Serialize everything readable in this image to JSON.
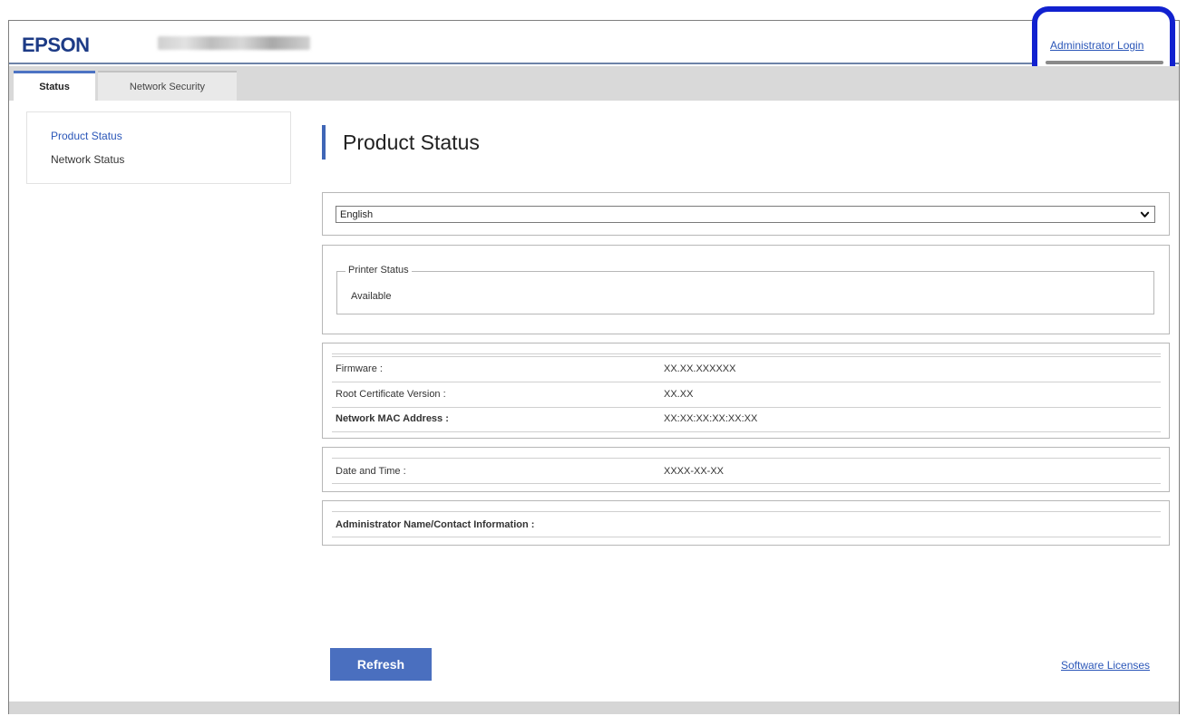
{
  "brand": {
    "logo": "EPSON"
  },
  "header": {
    "admin_login": "Administrator Login"
  },
  "tabs": [
    {
      "label": "Status",
      "active": true
    },
    {
      "label": "Network Security",
      "active": false
    }
  ],
  "sidebar": {
    "items": [
      {
        "label": "Product Status",
        "active": true
      },
      {
        "label": "Network Status",
        "active": false
      }
    ]
  },
  "main": {
    "title": "Product Status",
    "language": {
      "selected": "English"
    },
    "printer_status": {
      "legend": "Printer Status",
      "value": "Available"
    },
    "info": [
      {
        "label": "Firmware :",
        "value": "XX.XX.XXXXXX"
      },
      {
        "label": "Root Certificate Version :",
        "value": "XX.XX"
      },
      {
        "label": "Network MAC Address :",
        "value": "XX:XX:XX:XX:XX:XX"
      }
    ],
    "date_time": {
      "label": "Date and Time :",
      "value": "XXXX-XX-XX"
    },
    "admin_contact": {
      "label": "Administrator Name/Contact Information :"
    }
  },
  "footer": {
    "refresh_label": "Refresh",
    "licenses_link": "Software Licenses"
  },
  "colors": {
    "accent": "#3f66b6",
    "link": "#2a56b8",
    "highlight": "#1121cf",
    "button": "#4a6fbf"
  },
  "icons": {
    "select_arrow": "chevron-down-icon"
  }
}
